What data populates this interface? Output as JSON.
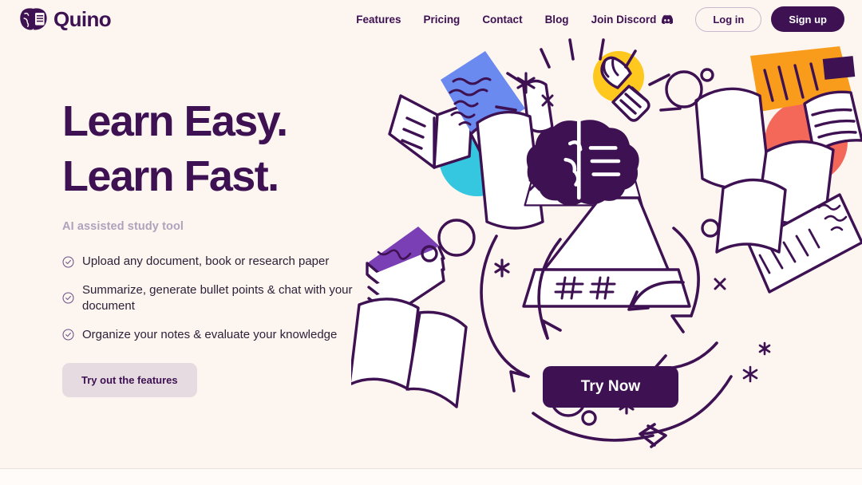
{
  "brand": {
    "name": "Quino",
    "logo_icon": "brain-document-icon"
  },
  "nav": {
    "links": [
      {
        "label": "Features",
        "icon": null
      },
      {
        "label": "Pricing",
        "icon": null
      },
      {
        "label": "Contact",
        "icon": null
      },
      {
        "label": "Blog",
        "icon": null
      },
      {
        "label": "Join Discord",
        "icon": "discord-icon"
      }
    ],
    "login_label": "Log in",
    "signup_label": "Sign up"
  },
  "hero": {
    "headline_line1": "Learn Easy.",
    "headline_line2": "Learn Fast.",
    "subhead": "AI assisted study tool",
    "features": [
      {
        "icon": "check-circle-icon",
        "text": "Upload any document, book or research paper"
      },
      {
        "icon": "check-circle-icon",
        "text": "Summarize, generate bullet points & chat with your document"
      },
      {
        "icon": "check-circle-icon",
        "text": "Organize your notes & evaluate your knowledge"
      }
    ],
    "cta_secondary": "Try out the features",
    "cta_primary": "Try Now"
  },
  "colors": {
    "background": "#FDF5F0",
    "ink": "#3D1152",
    "body_text": "#2B2238",
    "muted_text": "#AFA3BC",
    "button_soft": "#E6DBE0",
    "accent_blue": "#6B8AF0",
    "accent_yellow": "#FFC81E",
    "accent_orange": "#F99C1C",
    "accent_purple": "#7B3FB5",
    "accent_cyan": "#35C6E0",
    "accent_coral": "#F4685A",
    "paper_white": "#FFFFFF",
    "divider": "#EADFDC"
  },
  "illustration": {
    "name": "study-materials-collage",
    "elements": [
      "blue-note-paper",
      "white-open-book",
      "yellow-lightbulb",
      "orange-highlighted-page",
      "purple-book-stack",
      "cyan-circle",
      "coral-circle",
      "brain-laptop",
      "flying-papers",
      "curved-arrows",
      "asterisk-sparkles",
      "outline-circles"
    ]
  }
}
